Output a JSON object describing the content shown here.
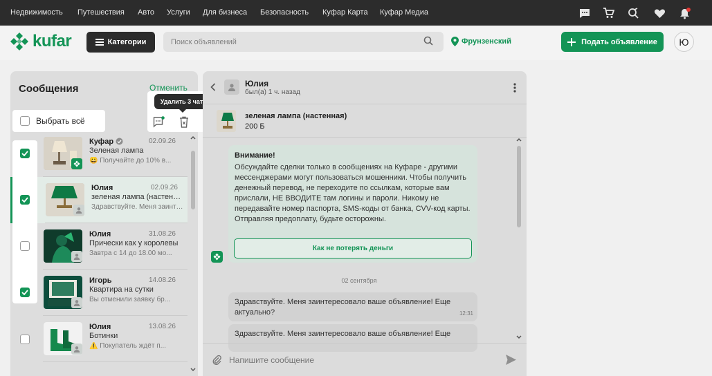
{
  "colors": {
    "brand": "#139456",
    "dark": "#2c2c2c",
    "notify": "#e53935"
  },
  "topnav": {
    "links": [
      "Недвижимость",
      "Путешествия",
      "Авто",
      "Услуги",
      "Для бизнеса",
      "Безопасность",
      "Куфар Карта",
      "Куфар Медиа"
    ],
    "icons": [
      "chat-icon",
      "cart-icon",
      "search-compare-icon",
      "heart-icon",
      "bell-icon"
    ]
  },
  "header": {
    "logo": "kufar",
    "categories_label": "Категории",
    "search_placeholder": "Поиск объявлений",
    "location": "Фрунзенский",
    "post_label": "Подать объявление",
    "avatar_letter": "Ю"
  },
  "left": {
    "title": "Сообщения",
    "cancel": "Отменить",
    "select_all": "Выбрать всё",
    "tooltip": "Удалить 3 чата",
    "chats": [
      {
        "name": "Куфар",
        "verified": true,
        "date": "02.09.26",
        "title": "Зеленая лампа",
        "preview": "😀 Получайте до 10% в...",
        "checked": true,
        "active": false
      },
      {
        "name": "Юлия",
        "date": "02.09.26",
        "title": "зеленая лампа (настенная)",
        "preview": "Здравствуйте. Меня заинтересовало...",
        "checked": true,
        "active": true
      },
      {
        "name": "Юлия",
        "date": "31.08.26",
        "title": "Прически как у королевы",
        "preview": "Завтра с 14 до 18.00 мо...",
        "checked": false,
        "active": false
      },
      {
        "name": "Игорь",
        "date": "14.08.26",
        "title": "Квартира на сутки",
        "preview": "Вы отменили заявку бр...",
        "checked": true,
        "active": false
      },
      {
        "name": "Юлия",
        "date": "13.08.26",
        "title": "Ботинки",
        "preview": "⚠️ Покупатель ждёт п...",
        "checked": false,
        "active": false
      }
    ]
  },
  "chat": {
    "user_name": "Юлия",
    "last_seen": "был(а) 1 ч. назад",
    "product_title": "зеленая лампа (настенная)",
    "product_price": "200 Б",
    "warning_title": "Внимание!",
    "warning_text": "Обсуждайте сделки только в сообщениях на Куфаре - другими мессенджерами могут пользоваться мошенники. Чтобы получить денежный перевод, не переходите по ссылкам, которые вам прислали, НЕ ВВОДИТЕ там логины и пароли. Никому не передавайте номер паспорта, SMS-коды от банка, CVV-код карты. Отправляя предоплату, будьте осторожны.",
    "warning_button": "Как не потерять деньги",
    "date_separator": "02 сентября",
    "messages": [
      {
        "text": "Здравствуйте. Меня заинтересовало ваше объявление! Еще актуально?",
        "time": "12:31"
      },
      {
        "text": "Здравствуйте. Меня заинтересовало ваше объявление! Еще",
        "time": ""
      }
    ],
    "input_placeholder": "Напишите сообщение"
  }
}
